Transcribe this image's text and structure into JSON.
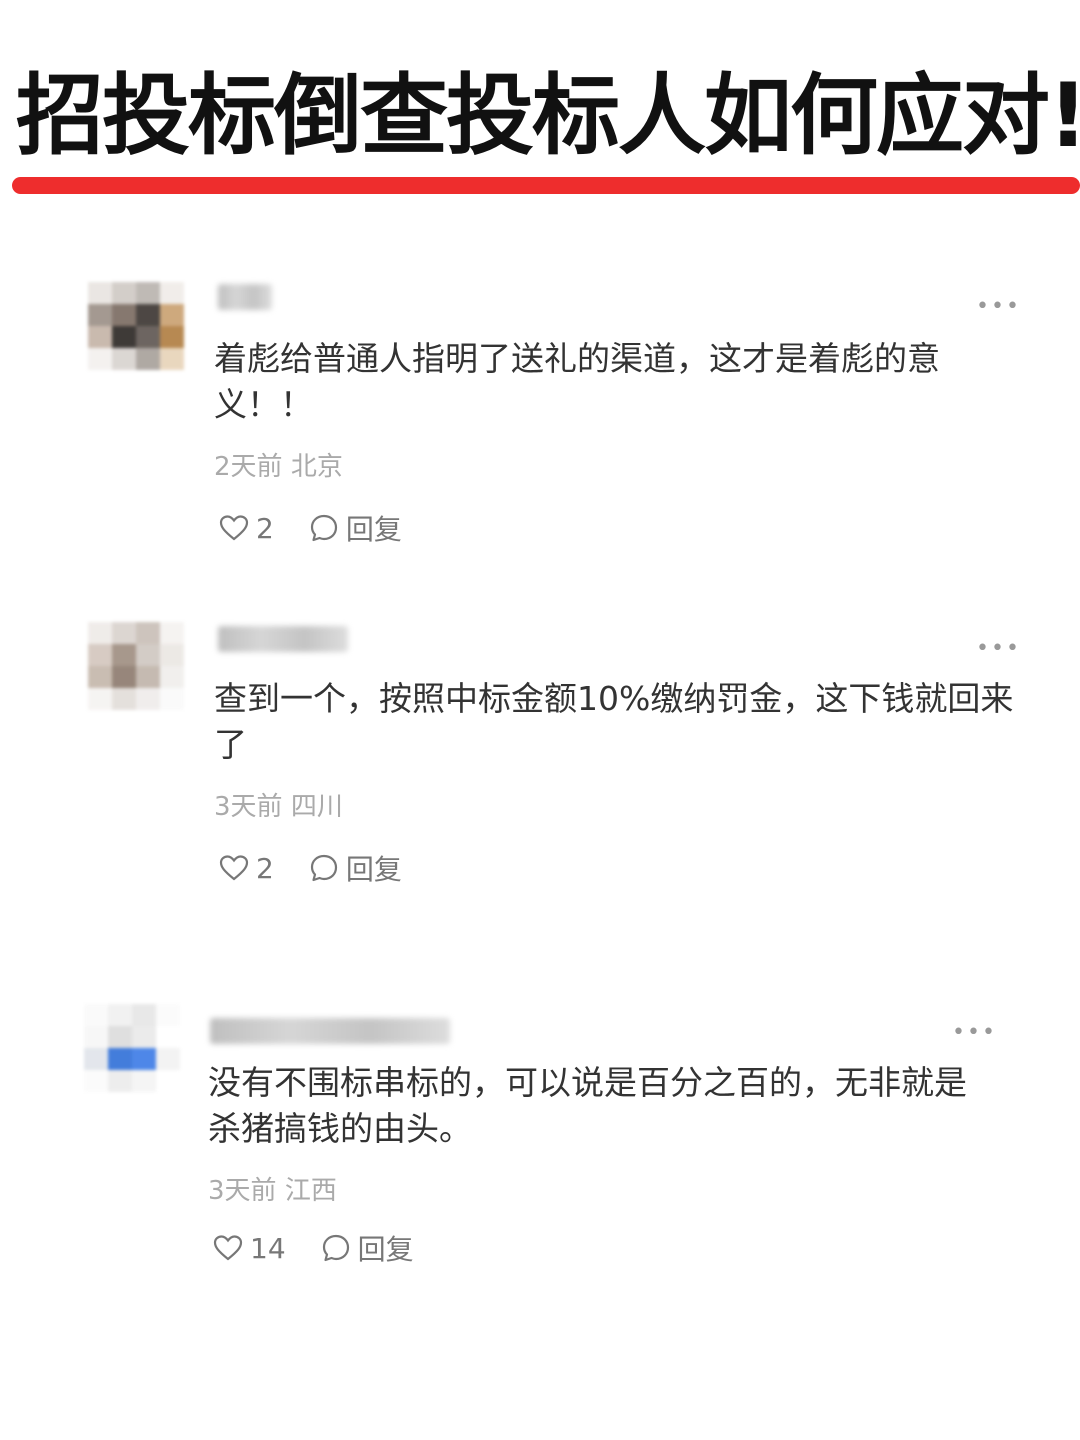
{
  "title": "招投标倒查投标人如何应对!",
  "colors": {
    "accent_bar": "#ee2d2d"
  },
  "comments": [
    {
      "text": "着彪给普通人指明了送礼的渠道，这才是着彪的意义！！",
      "time": "2天前",
      "location": "北京",
      "likes": "2",
      "reply_label": "回复",
      "more_icon": "more-dots-icon"
    },
    {
      "text": "查到一个，按照中标金额10%缴纳罚金，这下钱就回来了",
      "time": "3天前",
      "location": "四川",
      "likes": "2",
      "reply_label": "回复",
      "more_icon": "more-dots-icon"
    },
    {
      "text": "没有不围标串标的，可以说是百分之百的，无非就是杀猪搞钱的由头。",
      "time": "3天前",
      "location": "江西",
      "likes": "14",
      "reply_label": "回复",
      "more_icon": "more-dots-icon"
    }
  ]
}
